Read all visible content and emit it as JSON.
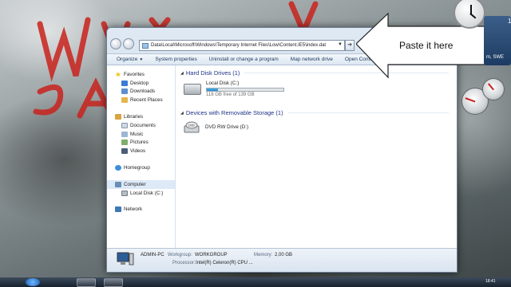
{
  "window": {
    "address": "Data\\Local\\Microsoft\\Windows\\Temporary Internet Files\\Low\\Content.IE5\\index.dat",
    "go_arrow": "➔"
  },
  "toolbar": {
    "items": [
      "Organize",
      "System properties",
      "Uninstall or change a program",
      "Map network drive",
      "Open Control P"
    ]
  },
  "nav": {
    "favorites": "Favorites",
    "desktop": "Desktop",
    "downloads": "Downloads",
    "recent_places": "Recent Places",
    "libraries": "Libraries",
    "documents": "Documents",
    "music": "Music",
    "pictures": "Pictures",
    "videos": "Videos",
    "homegroup": "Homegroup",
    "computer": "Computer",
    "local_disk": "Local Disk (C:)",
    "network": "Network"
  },
  "main": {
    "hdd_header": "Hard Disk Drives (1)",
    "removable_header": "Devices with Removable Storage (1)",
    "local_disk_name": "Local Disk (C:)",
    "local_disk_free": "118 GB free of 139 GB",
    "local_disk_used_fraction": 0.15,
    "dvd_name": "DVD RW Drive (D:)",
    "dvd_badge": "DVD"
  },
  "details": {
    "pc_name": "ADMIN-PC",
    "workgroup_label": "Workgroup:",
    "workgroup_value": "WORKGROUP",
    "memory_label": "Memory:",
    "memory_value": "2,00 GB",
    "processor_label": "Processor:",
    "processor_value": "Intel(R) Celeron(R) CPU ..."
  },
  "callout": {
    "text": "Paste it here"
  },
  "gadgets": {
    "calendar_day": "1",
    "calendar_text": "m, SWE"
  },
  "taskbar": {
    "time": "18:41"
  },
  "colors": {
    "accent": "#1e3287",
    "toolbar_text": "#1e395b",
    "bar_fill": "#1f86cc"
  }
}
